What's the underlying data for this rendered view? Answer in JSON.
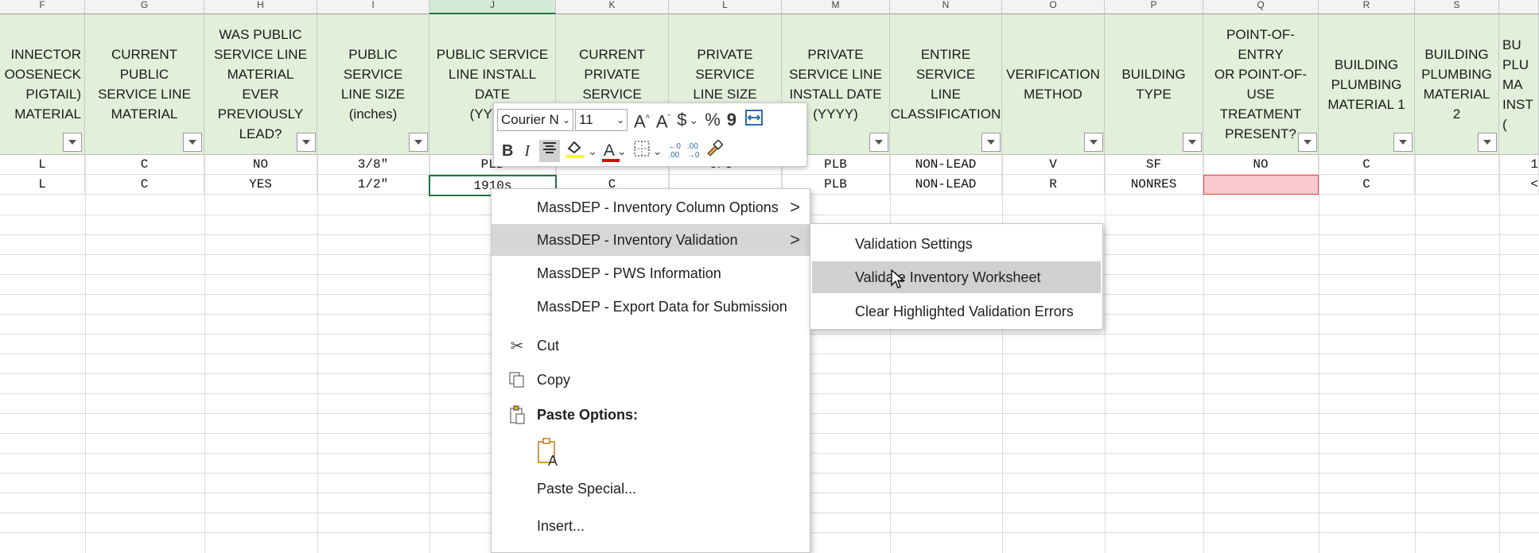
{
  "column_letters": [
    "F",
    "G",
    "H",
    "I",
    "J",
    "K",
    "L",
    "M",
    "N",
    "O",
    "P",
    "Q",
    "R",
    "S",
    ""
  ],
  "headers": [
    "INNECTOR\nOOSENECK\nPIGTAIL)\nMATERIAL",
    "CURRENT PUBLIC\nSERVICE LINE\nMATERIAL",
    "WAS PUBLIC\nSERVICE LINE\nMATERIAL EVER\nPREVIOUSLY\nLEAD?",
    "PUBLIC SERVICE\nLINE SIZE\n(inches)",
    "PUBLIC SERVICE\nLINE INSTALL DATE\n(YYYY)",
    "CURRENT\nPRIVATE SERVICE\nLINE MATERIAL",
    "PRIVATE SERVICE\nLINE SIZE\n(inches)",
    "PRIVATE\nSERVICE LINE\nINSTALL DATE\n(YYYY)",
    "ENTIRE SERVICE\nLINE\nCLASSIFICATION",
    "VERIFICATION\nMETHOD",
    "BUILDING\nTYPE",
    "POINT-OF-ENTRY\nOR POINT-OF-\nUSE TREATMENT\nPRESENT?",
    "BUILDING\nPLUMBING\nMATERIAL 1",
    "BUILDING\nPLUMBING\nMATERIAL 2",
    "BU\nPLU\nMA\nINST\n("
  ],
  "rows": [
    [
      "L",
      "C",
      "NO",
      "3/8\"",
      "PLB",
      "",
      "5/8\"",
      "PLB",
      "NON-LEAD",
      "V",
      "SF",
      "NO",
      "C",
      "",
      "1"
    ],
    [
      "L",
      "C",
      "YES",
      "1/2\"",
      "1910s",
      "C",
      "",
      "PLB",
      "NON-LEAD",
      "R",
      "NONRES",
      "",
      "C",
      "",
      "<"
    ]
  ],
  "mini_toolbar": {
    "font_name": "Courier N",
    "font_size": "11",
    "grow_font": "A",
    "shrink_font": "A",
    "currency": "$",
    "percent": "%",
    "comma": "9",
    "bold": "B",
    "italic": "I",
    "font_color_letter": "A",
    "inc_decimal": "←0\n.00",
    "dec_decimal": ".00\n→0"
  },
  "context_menu": {
    "items": [
      {
        "label": "MassDEP - Inventory Column Options",
        "submenu": true
      },
      {
        "label": "MassDEP - Inventory Validation",
        "submenu": true
      },
      {
        "label": "MassDEP - PWS Information",
        "submenu": false
      },
      {
        "label": "MassDEP - Export Data for Submission",
        "submenu": false
      },
      {
        "label": "Cut",
        "icon": "scissors-icon"
      },
      {
        "label": "Copy",
        "icon": "copy-icon"
      },
      {
        "label": "Paste Options:",
        "icon": "paste-icon"
      },
      {
        "label": "Paste Special..."
      },
      {
        "label": "Insert..."
      }
    ],
    "arrow_glyph": ">"
  },
  "submenu": {
    "items": [
      "Validation Settings",
      "Validate Inventory Worksheet",
      "Clear Highlighted Validation Errors"
    ]
  },
  "colors": {
    "header_bg": "#e2efda",
    "active_border": "#217346",
    "error_fill": "#f8c9cd",
    "error_border": "#e24a4a",
    "menu_highlight": "#d6d6d6"
  }
}
